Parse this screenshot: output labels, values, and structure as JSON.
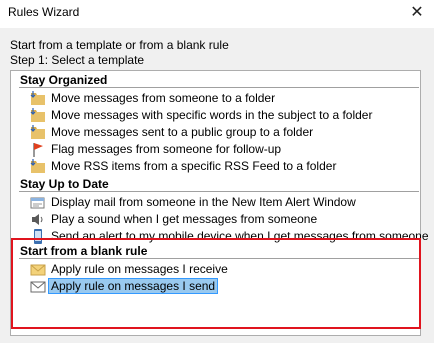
{
  "window": {
    "title": "Rules Wizard"
  },
  "intro": {
    "line1": "Start from a template or from a blank rule",
    "line2": "Step 1: Select a template"
  },
  "groups": [
    {
      "heading": "Stay Organized",
      "items": [
        {
          "label": "Move messages from someone to a folder",
          "icon": "folder-arrow-icon"
        },
        {
          "label": "Move messages with specific words in the subject to a folder",
          "icon": "folder-arrow-icon"
        },
        {
          "label": "Move messages sent to a public group to a folder",
          "icon": "folder-arrow-icon"
        },
        {
          "label": "Flag messages from someone for follow-up",
          "icon": "flag-icon"
        },
        {
          "label": "Move RSS items from a specific RSS Feed to a folder",
          "icon": "folder-arrow-icon"
        }
      ]
    },
    {
      "heading": "Stay Up to Date",
      "items": [
        {
          "label": "Display mail from someone in the New Item Alert Window",
          "icon": "alert-window-icon"
        },
        {
          "label": "Play a sound when I get messages from someone",
          "icon": "speaker-icon"
        },
        {
          "label": "Send an alert to my mobile device when I get messages from someone",
          "icon": "mobile-icon"
        }
      ]
    },
    {
      "heading": "Start from a blank rule",
      "items": [
        {
          "label": "Apply rule on messages I receive",
          "icon": "envelope-icon"
        },
        {
          "label": "Apply rule on messages I send",
          "icon": "outbox-icon",
          "selected": true
        }
      ]
    }
  ],
  "colors": {
    "selection_fill": "#99c9ef",
    "selection_border": "#3399ff",
    "annotation": "#e0141e"
  }
}
